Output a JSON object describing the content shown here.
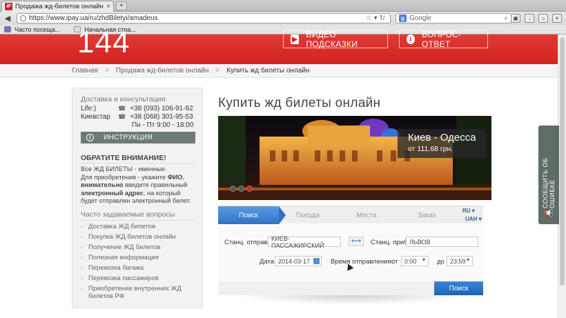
{
  "browser": {
    "tab_title": "Продажа жд-билетов онлайн |...",
    "tab_close": "×",
    "new_tab": "+",
    "url": "https://www.ipay.ua/ru/zhdBiletyi/amadeus",
    "search_placeholder": "Google",
    "bookmarks": [
      {
        "label": "Часто посеща..."
      },
      {
        "label": "Начальная стра..."
      }
    ]
  },
  "header": {
    "phone_short": "144",
    "video_button": "ВИДЕО ПОДСКАЗКИ",
    "faq_button": "ВОПРОС-ОТВЕТ",
    "info_glyph": "i"
  },
  "breadcrumb": {
    "items": [
      "Главная",
      "Продажа жд-билетов онлайн",
      "Купить жд билеты онлайн"
    ],
    "separator": ">"
  },
  "sidebar": {
    "contact_title": "Доставка и консультация:",
    "contacts": [
      {
        "operator": "Life:)",
        "phone": "+38 (093) 106-91-92"
      },
      {
        "operator": "Киевстар",
        "phone": "+38 (068) 301-95-53"
      }
    ],
    "hours": "Пн - Пт 9:00 - 18:00",
    "instruction_button": "ИНСТРУКЦИЯ",
    "attention_title": "ОБРАТИТЕ ВНИМАНИЕ!",
    "attention_line1": "Все ЖД БИЛЕТЫ - именные.",
    "attention_line2_pre": "Для приобретения - укажите ",
    "attention_fio": "ФИО",
    "attention_comma": ",",
    "attention_careful": "внимательно",
    "attention_line3_mid": " введите правильный",
    "attention_email": "электронный адрес",
    "attention_line4_post": ", на который",
    "attention_line5": "будет отправлен электронный билет.",
    "faq_title": "Часто задаваемые вопросы",
    "faq_items": [
      "Доставка ЖД билетов",
      "Покупка ЖД билетов онлайн",
      "Получение ЖД билетов",
      "Полезная информация",
      "Перевозка багажа",
      "Перевозка пассажиров",
      "Приобретение внутренних ЖД билетов РФ"
    ]
  },
  "main": {
    "title": "Купить жд билеты онлайн",
    "banner": {
      "route": "Киев - Одесса",
      "price": "от 111,68 грн."
    },
    "steps": [
      "Поиск",
      "Поезда",
      "Места",
      "Заказ"
    ],
    "lang": "RU",
    "currency": "UAH",
    "form": {
      "from_label": "Станц. отправл.",
      "from_value": "КИЕВ-ПАССАЖИРСКИЙ",
      "to_label": "Станц. приб.",
      "to_value": "ЛЬВОВ",
      "date_label": "Дата",
      "date_value": "2014-03-17",
      "time_label": "Время отправления:",
      "from_time_label": "от",
      "from_time": "0:00",
      "to_time_label": "до",
      "to_time": "23:59",
      "search_button": "Поиск"
    }
  },
  "feedback": {
    "label": "СООБЩИТЬ ОБ ОШИБКЕ"
  },
  "colors": {
    "brand_red": "#d02420",
    "step_blue": "#2f73c9",
    "sidebar_gray": "#6c7b73"
  }
}
